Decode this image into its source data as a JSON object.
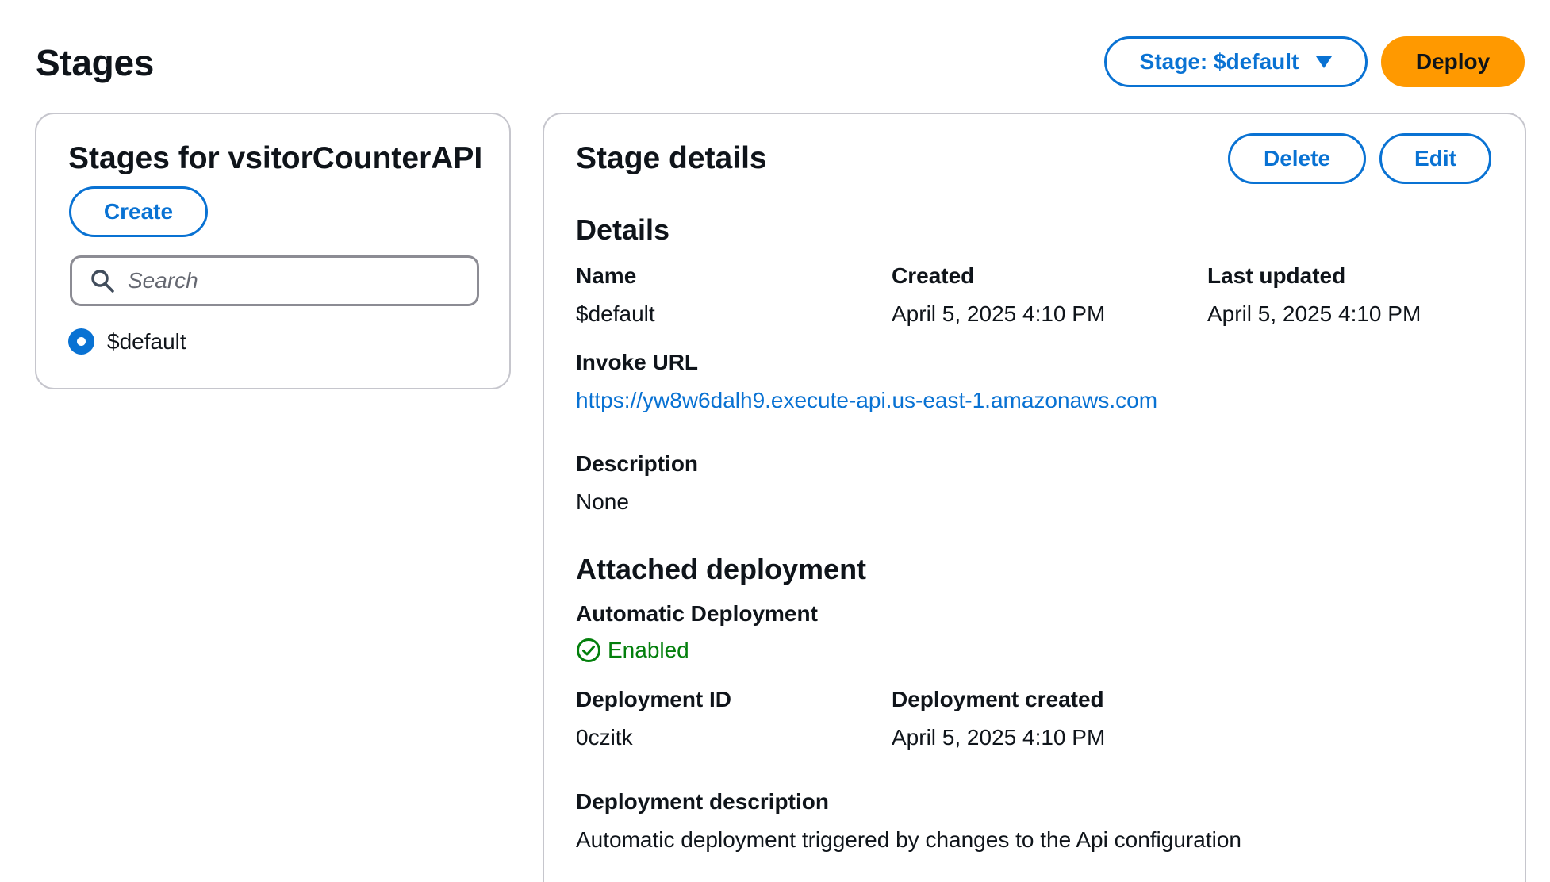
{
  "header": {
    "title": "Stages",
    "stage_selector_label": "Stage: $default",
    "deploy_label": "Deploy"
  },
  "stages_panel": {
    "title": "Stages for vsitorCounterAPI",
    "create_label": "Create",
    "search_placeholder": "Search",
    "stages": [
      {
        "name": "$default",
        "selected": true
      }
    ]
  },
  "stage_details": {
    "title": "Stage details",
    "delete_label": "Delete",
    "edit_label": "Edit",
    "details": {
      "heading": "Details",
      "name_label": "Name",
      "name_value": "$default",
      "created_label": "Created",
      "created_value": "April 5, 2025 4:10 PM",
      "updated_label": "Last updated",
      "updated_value": "April 5, 2025 4:10 PM",
      "invoke_url_label": "Invoke URL",
      "invoke_url_value": "https://yw8w6dalh9.execute-api.us-east-1.amazonaws.com",
      "description_label": "Description",
      "description_value": "None"
    },
    "attached_deployment": {
      "heading": "Attached deployment",
      "auto_label": "Automatic Deployment",
      "auto_value": "Enabled",
      "id_label": "Deployment ID",
      "id_value": "0czitk",
      "created_label": "Deployment created",
      "created_value": "April 5, 2025 4:10 PM",
      "desc_label": "Deployment description",
      "desc_value": "Automatic deployment triggered by changes to the Api configuration"
    }
  },
  "colors": {
    "accent": "#0972d3",
    "primary_button": "#ff9900",
    "success": "#037f0c",
    "border": "#c6c6cd"
  },
  "icons": {
    "search": "search-icon",
    "dropdown": "caret-down-icon",
    "status": "check-circle-icon"
  }
}
